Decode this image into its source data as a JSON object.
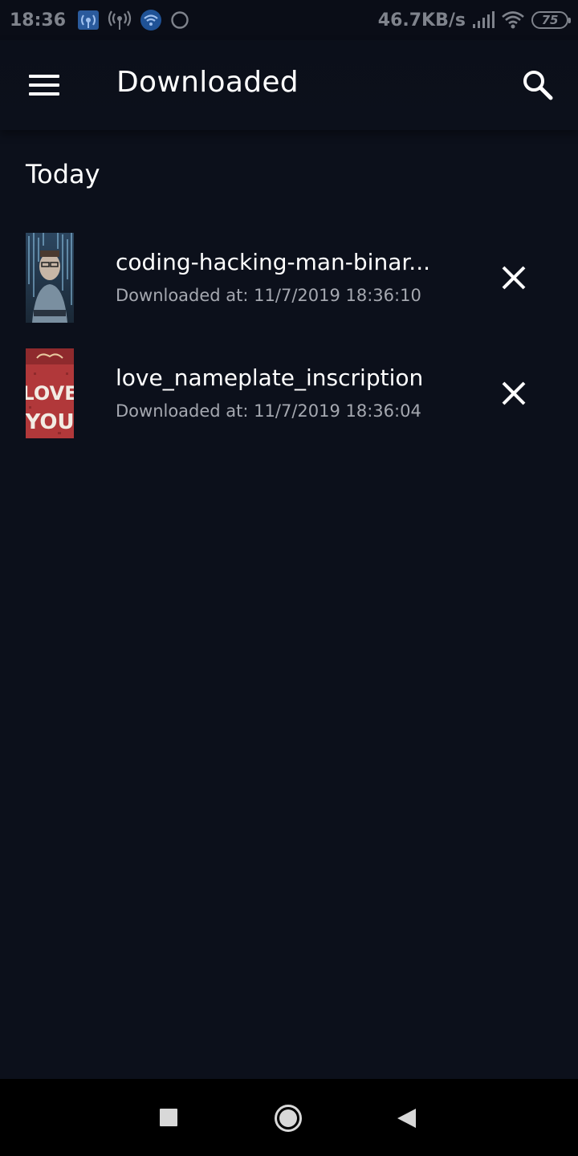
{
  "status_bar": {
    "time": "18:36",
    "network_speed": "46.7KB/s",
    "battery_level": "75",
    "icons": [
      "hotspot-icon",
      "wireless-signal-icon",
      "wifi-badge-icon",
      "circle-icon",
      "cell-signal-icon",
      "wifi-icon",
      "battery-icon"
    ]
  },
  "app_bar": {
    "title": "Downloaded",
    "menu_icon": "hamburger-menu-icon",
    "search_icon": "search-icon"
  },
  "section": {
    "heading": "Today"
  },
  "downloads": [
    {
      "title": "coding-hacking-man-binar...",
      "subtitle": "Downloaded at: 11/7/2019 18:36:10",
      "thumbnail": "man-binary-code-thumbnail"
    },
    {
      "title": "love_nameplate_inscription",
      "subtitle": "Downloaded at: 11/7/2019 18:36:04",
      "thumbnail": "love-you-sign-thumbnail"
    }
  ],
  "nav_bar": {
    "icons": [
      "recents-square-icon",
      "home-circle-icon",
      "back-triangle-icon"
    ]
  },
  "colors": {
    "background": "#0c101b",
    "status_bar": "#0a0d17",
    "text_primary": "#ffffff",
    "text_secondary": "#a5a8b0",
    "nav_bar": "#000000"
  }
}
